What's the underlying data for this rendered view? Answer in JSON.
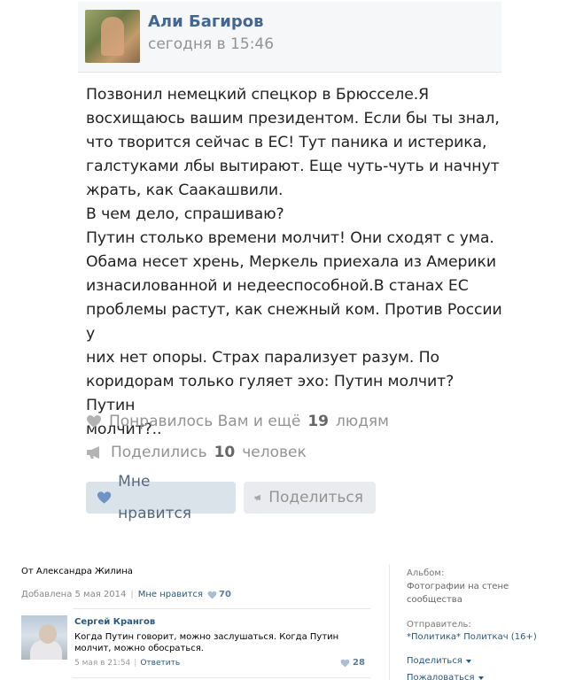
{
  "post": {
    "author": "Али Багиров",
    "time": "сегодня в 15:46",
    "text": "Позвонил немецкий спецкор в Брюсселе.Я\nвосхищаюсь вашим президентом. Если бы ты знал,\nчто творится сейчас в ЕС! Тут паника и истерика,\nгалстуками лбы вытирают. Еще чуть-чуть и начнут\nжрать, как Саакашвили.\nВ чем дело, спрашиваю?\nПутин столько времени молчит! Они сходят с ума.\nОбама несет хрень, Меркель приехала из Америки\nизнасилованной и недееспособной.В станах ЕС\nпроблемы растут, как снежный ком. Против России у\nних нет опоры. Страх парализует разум. По\nкоридорам только гуляет эхо: Путин молчит? Путин\nмолчит?..",
    "likes_prefix": "Понравилось Вам и ещё",
    "likes_count": "19",
    "likes_suffix": "людям",
    "shares_prefix": "Поделились",
    "shares_count": "10",
    "shares_suffix": "человек",
    "like_button": "Мне нравится",
    "share_button": "Поделиться"
  },
  "photo_page": {
    "from": "От Александра Жилина",
    "added": "Добавлена 5 мая 2014",
    "like_link": "Мне нравится",
    "like_count": "70",
    "comment": {
      "author": "Сергей Крангов",
      "text": "Когда Путин говорит, можно заслушаться. Когда Путин\nмолчит, можно обосраться.",
      "time": "5 мая в 21:54",
      "reply": "Ответить",
      "likes": "28"
    },
    "sidebar": {
      "album_label": "Альбом:",
      "album_value": "Фотографии на стене\nсообщества",
      "sender_label": "Отправитель:",
      "sender_value": "*Политика* Политкач (16+)",
      "share": "Поделиться",
      "report": "Пожаловаться"
    }
  },
  "colors": {
    "link": "#45668e",
    "muted": "#939393",
    "like_button_bg": "#dae2ea",
    "share_button_bg": "#e9ebee"
  },
  "icons": [
    "heart-icon",
    "megaphone-icon",
    "chevron-down-icon"
  ]
}
